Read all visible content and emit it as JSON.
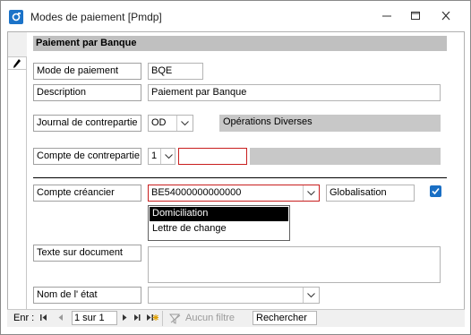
{
  "window": {
    "title": "Modes de paiement [Pmdp]",
    "controls": [
      "minimize-icon",
      "maximize-icon",
      "close-icon"
    ]
  },
  "form": {
    "section_title": "Paiement par Banque",
    "mode_paiement": {
      "label": "Mode de paiement",
      "value": "BQE"
    },
    "description": {
      "label": "Description",
      "value": "Paiement par Banque"
    },
    "journal": {
      "label": "Journal de contrepartie",
      "value": "OD",
      "name": "Opérations  Diverses"
    },
    "compte_contrepartie": {
      "label": "Compte de contrepartie",
      "type_value": "1",
      "value": "",
      "name": ""
    },
    "compte_creancier": {
      "label": "Compte créancier",
      "value": "BE54000000000000",
      "globalisation_label": "Globalisation",
      "globalisation_checked": true
    },
    "dropdown_options": [
      {
        "label": "Domiciliation",
        "selected": true
      },
      {
        "label": "Lettre de change",
        "selected": false
      }
    ],
    "texte_document": {
      "label": "Texte sur document",
      "value": ""
    },
    "nom_etat": {
      "label": "Nom de l' état",
      "value": ""
    }
  },
  "navigation": {
    "record_label": "Enr :",
    "record_value": "1 sur 1",
    "filter_label": "Aucun filtre",
    "search_label": "Rechercher"
  },
  "colors": {
    "accent": "#1a6fc4",
    "error_border": "#c81e1e",
    "section_bg": "#c0c0c0"
  }
}
